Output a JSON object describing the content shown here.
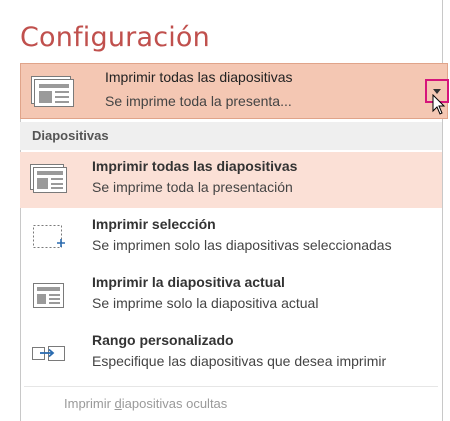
{
  "title": "Configuración",
  "combo": {
    "title": "Imprimir todas las diapositivas",
    "subtitle": "Se imprime toda la presenta...",
    "icon": "slides-thumbnail-icon",
    "dropdown_icon": "chevron-down-icon"
  },
  "section_header": "Diapositivas",
  "items": [
    {
      "title": "Imprimir todas las diapositivas",
      "subtitle": "Se imprime toda la presentación",
      "icon": "slides-thumbnail-icon",
      "selected": true
    },
    {
      "title": "Imprimir selección",
      "subtitle": "Se imprimen solo las diapositivas seleccionadas",
      "icon": "selection-icon",
      "selected": false
    },
    {
      "title": "Imprimir la diapositiva actual",
      "subtitle": "Se imprime solo la diapositiva actual",
      "icon": "current-slide-icon",
      "selected": false
    },
    {
      "title": "Rango personalizado",
      "subtitle": "Especifique las diapositivas que desea imprimir",
      "icon": "custom-range-icon",
      "selected": false
    }
  ],
  "hidden_slides": {
    "before": "Imprimir ",
    "underlined": "d",
    "after": "iapositivas ocultas"
  },
  "colors": {
    "title": "#c0504d",
    "combo_bg": "#f4c7b3",
    "selected_bg": "#fbe0d6",
    "highlight_border": "#d6157b"
  }
}
